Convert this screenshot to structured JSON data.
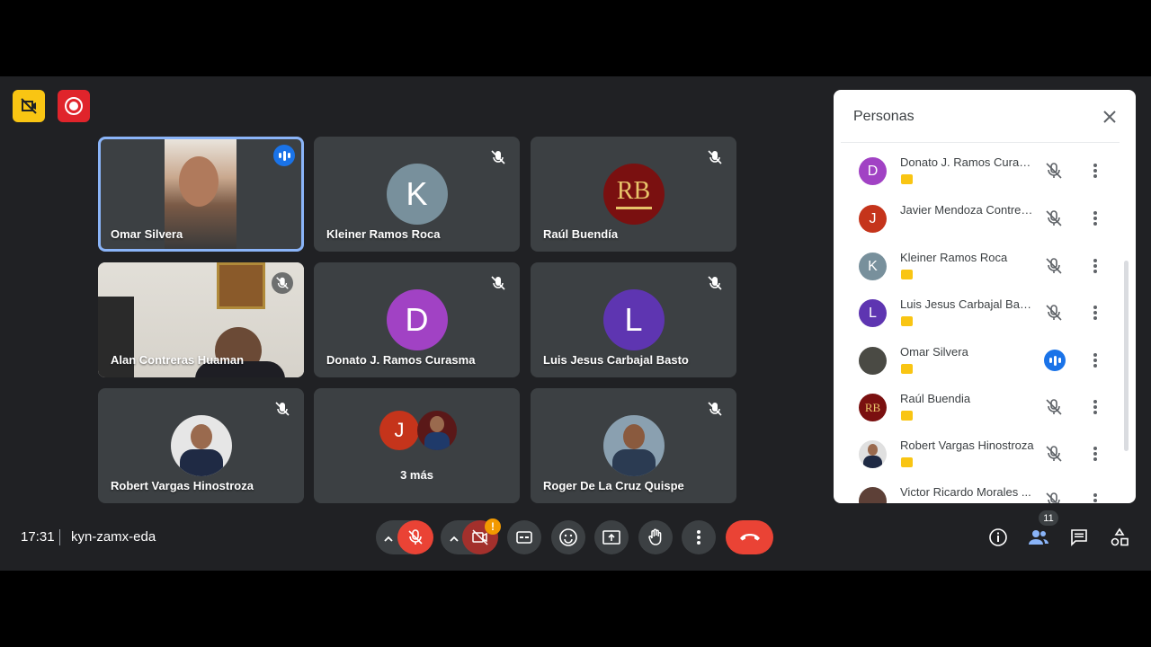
{
  "tiles": [
    {
      "name": "Omar Silvera",
      "speaking": true
    },
    {
      "name": "Kleiner Ramos Roca",
      "initial": "K",
      "color": "#78909c",
      "muted": true
    },
    {
      "name": "Raúl Buendía",
      "logo_text": "RB",
      "muted": true
    },
    {
      "name": "Alan Contreras Huaman",
      "muted": true
    },
    {
      "name": "Donato J. Ramos Curasma",
      "initial": "D",
      "color": "#a142c4",
      "muted": true
    },
    {
      "name": "Luis Jesus Carbajal Basto",
      "initial": "L",
      "color": "#5e35b1",
      "muted": true
    },
    {
      "name": "Robert Vargas Hinostroza",
      "muted": true
    },
    {
      "name": "3 más",
      "initial": "J",
      "color": "#c5341b"
    },
    {
      "name": "Roger De La Cruz Quispe",
      "muted": true
    }
  ],
  "panel": {
    "title": "Personas",
    "people": [
      {
        "name": "Donato J. Ramos Curasma",
        "initial": "D",
        "color": "#a142c4",
        "state": "muted"
      },
      {
        "name": "Javier Mendoza Contreras",
        "initial": "J",
        "color": "#c5341b",
        "state": "muted"
      },
      {
        "name": "Kleiner Ramos Roca",
        "initial": "K",
        "color": "#78909c",
        "state": "muted"
      },
      {
        "name": "Luis Jesus Carbajal Basto",
        "initial": "L",
        "color": "#5e35b1",
        "state": "muted"
      },
      {
        "name": "Omar Silvera",
        "color": "#4a4a44",
        "state": "speaking"
      },
      {
        "name": "Raúl Buendia",
        "color": "#7a1010",
        "state": "muted"
      },
      {
        "name": "Robert Vargas Hinostroza",
        "color": "#3d5a80",
        "state": "muted"
      },
      {
        "name": "Victor Ricardo Morales ...",
        "color": "#5d4037",
        "state": "muted"
      }
    ]
  },
  "bottom": {
    "time": "17:31",
    "meeting_code": "kyn-zamx-eda",
    "participants_count": "11",
    "camera_warning": "!"
  },
  "colors": {
    "accent": "#1a73e8",
    "danger": "#ea4335",
    "bg": "#202124",
    "tile": "#3c4043"
  }
}
